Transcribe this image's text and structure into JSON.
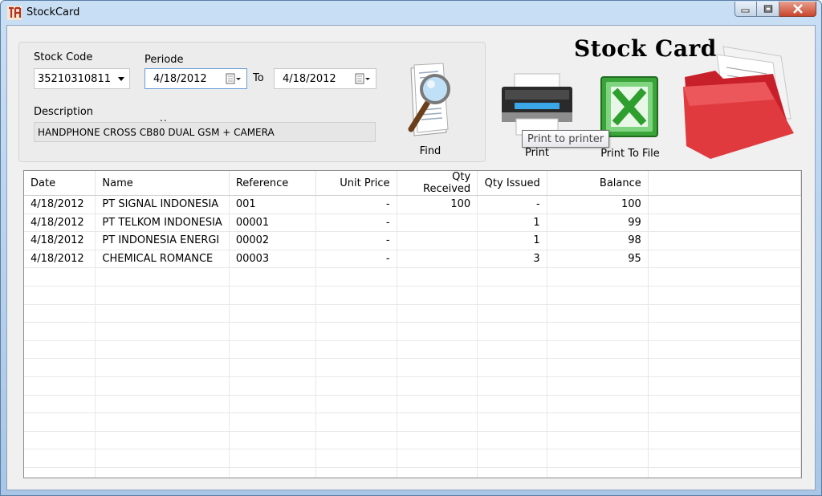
{
  "window": {
    "title": "StockCard"
  },
  "form": {
    "stock_code_label": "Stock Code",
    "stock_code_value": "35210310811",
    "periode_label": "Periode",
    "date_from": "4/18/2012",
    "to_label": "To",
    "date_to": "4/18/2012",
    "ellipsis": "..",
    "description_label": "Description",
    "description_value": "HANDPHONE CROSS CB80 DUAL GSM + CAMERA"
  },
  "toolbar": {
    "find_label": "Find",
    "print_label": "Print",
    "print_to_file_label": "Print To File",
    "tooltip": "Print to printer"
  },
  "heading": "Stock Card",
  "table": {
    "columns": [
      "Date",
      "Name",
      "Reference",
      "Unit Price",
      "Qty Received",
      "Qty Issued",
      "Balance"
    ],
    "rows": [
      [
        "4/18/2012",
        "PT SIGNAL INDONESIA",
        "001",
        "-",
        "100",
        "-",
        "100"
      ],
      [
        "4/18/2012",
        "PT TELKOM INDONESIA",
        "00001",
        "-",
        "",
        "1",
        "99"
      ],
      [
        "4/18/2012",
        "PT INDONESIA ENERGI",
        "00002",
        "-",
        "",
        "1",
        "98"
      ],
      [
        "4/18/2012",
        "CHEMICAL ROMANCE",
        "00003",
        "-",
        "",
        "3",
        "95"
      ]
    ]
  },
  "colors": {
    "title_gradient_top": "#c9dff4",
    "client_bg": "#f0f0f0",
    "excel_green": "#2e9e2e",
    "folder_red": "#c8202a"
  },
  "icons": [
    "app-icon",
    "minimize-icon",
    "maximize-icon",
    "close-icon",
    "chevron-down-icon",
    "calendar-icon",
    "find-magnifier-icon",
    "printer-icon",
    "excel-icon",
    "red-folder-icon"
  ]
}
